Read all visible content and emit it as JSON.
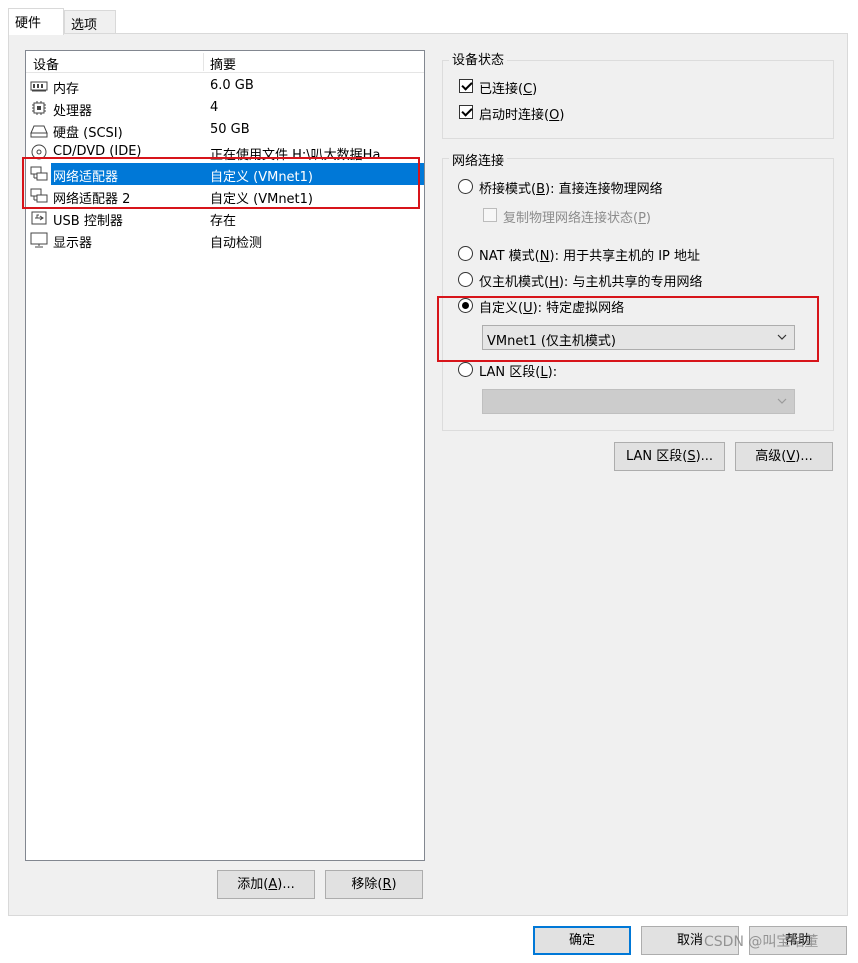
{
  "tabs": [
    {
      "label": "硬件",
      "active": true
    },
    {
      "label": "选项",
      "active": false
    }
  ],
  "device_list": {
    "columns": [
      "设备",
      "摘要"
    ],
    "rows": [
      {
        "icon": "memory-icon",
        "name": "内存",
        "summary": "6.0 GB"
      },
      {
        "icon": "processor-icon",
        "name": "处理器",
        "summary": "4"
      },
      {
        "icon": "hard-disk-icon",
        "name": "硬盘 (SCSI)",
        "summary": "50 GB"
      },
      {
        "icon": "cd-dvd-icon",
        "name": "CD/DVD (IDE)",
        "summary": "正在使用文件 H:\\叭大数据Ha..."
      },
      {
        "icon": "network-adapter-icon",
        "name": "网络适配器",
        "summary": "自定义 (VMnet1)",
        "selected": true
      },
      {
        "icon": "network-adapter-icon",
        "name": "网络适配器 2",
        "summary": "自定义 (VMnet1)"
      },
      {
        "icon": "usb-icon",
        "name": "USB 控制器",
        "summary": "存在"
      },
      {
        "icon": "display-icon",
        "name": "显示器",
        "summary": "自动检测"
      }
    ]
  },
  "list_buttons": {
    "add": {
      "text": "添加(",
      "key": "A",
      "suffix": ")..."
    },
    "remove": {
      "text": "移除(",
      "key": "R",
      "suffix": ")"
    }
  },
  "device_status": {
    "title": "设备状态",
    "connected": {
      "text": "已连接(",
      "key": "C",
      "suffix": ")",
      "checked": true
    },
    "connect_on_power": {
      "text": "启动时连接(",
      "key": "O",
      "suffix": ")",
      "checked": true
    }
  },
  "network": {
    "title": "网络连接",
    "bridged": {
      "text": "桥接模式(",
      "key": "B",
      "suffix": "): 直接连接物理网络",
      "checked": false
    },
    "replicate": {
      "text": "复制物理网络连接状态(",
      "key": "P",
      "suffix": ")",
      "checked": false
    },
    "nat": {
      "text": "NAT 模式(",
      "key": "N",
      "suffix": "): 用于共享主机的 IP 地址",
      "checked": false
    },
    "host_only": {
      "text": "仅主机模式(",
      "key": "H",
      "suffix": "): 与主机共享的专用网络",
      "checked": false
    },
    "custom": {
      "text": "自定义(",
      "key": "U",
      "suffix": "): 特定虚拟网络",
      "checked": true
    },
    "custom_value": "VMnet1 (仅主机模式)",
    "lan": {
      "text": "LAN 区段(",
      "key": "L",
      "suffix": "):",
      "checked": false
    },
    "lan_value": ""
  },
  "network_buttons": {
    "lan_segments": {
      "text": "LAN 区段(",
      "key": "S",
      "suffix": ")..."
    },
    "advanced": {
      "text": "高级(",
      "key": "V",
      "suffix": ")..."
    }
  },
  "dialog_buttons": {
    "ok": "确定",
    "cancel": "取消",
    "help": "帮助"
  },
  "watermark": "CSDN @叫宝咕董",
  "colors": {
    "selection": "#0078d7",
    "highlight_box": "#d7141a",
    "panel_bg": "#f0f0f0"
  }
}
